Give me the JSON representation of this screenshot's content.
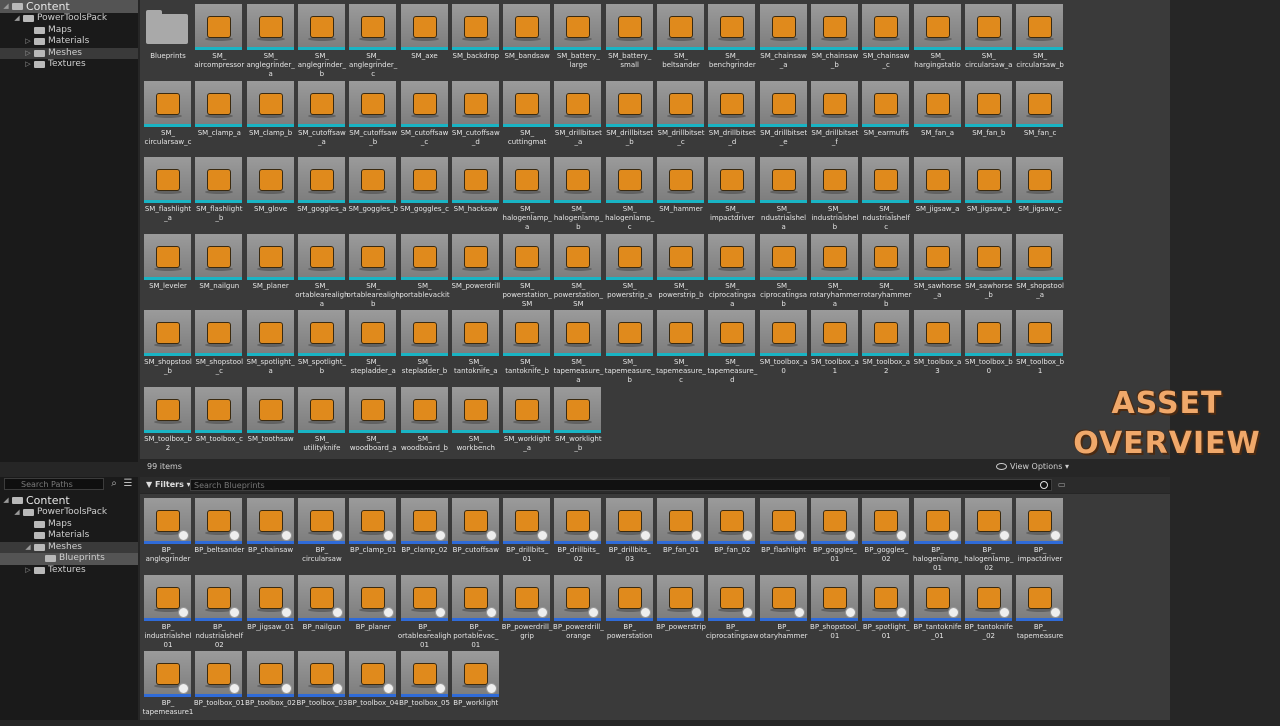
{
  "top_tree": [
    {
      "label": "Content",
      "level": 0,
      "root": true,
      "arrow": "◢",
      "selected": true
    },
    {
      "label": "PowerToolsPack",
      "level": 1,
      "arrow": "◢"
    },
    {
      "label": "Maps",
      "level": 2,
      "arrow": ""
    },
    {
      "label": "Materials",
      "level": 2,
      "arrow": "▷"
    },
    {
      "label": "Meshes",
      "level": 2,
      "arrow": "▷",
      "highlight": true
    },
    {
      "label": "Textures",
      "level": 2,
      "arrow": "▷"
    }
  ],
  "bottom_tree": [
    {
      "label": "Content",
      "level": 0,
      "root": true,
      "arrow": "◢"
    },
    {
      "label": "PowerToolsPack",
      "level": 1,
      "arrow": "◢"
    },
    {
      "label": "Maps",
      "level": 2,
      "arrow": ""
    },
    {
      "label": "Materials",
      "level": 2,
      "arrow": ""
    },
    {
      "label": "Meshes",
      "level": 2,
      "arrow": "◢",
      "highlight": true
    },
    {
      "label": "Blueprints",
      "level": 3,
      "arrow": "",
      "selected": true
    },
    {
      "label": "Textures",
      "level": 2,
      "arrow": "▷"
    }
  ],
  "search_paths_placeholder": "Search Paths",
  "mesh_assets": [
    "Blueprints",
    "SM_\naircompressor",
    "SM_\nanglegrinder_\na",
    "SM_\nanglegrinder_\nb",
    "SM_\nanglegrinder_\nc",
    "SM_axe",
    "SM_backdrop",
    "SM_bandsaw",
    "SM_battery_\nlarge",
    "SM_battery_\nsmall",
    "SM_\nbeltsander",
    "SM_\nbenchgrinder",
    "SM_chainsaw\n_a",
    "SM_chainsaw\n_b",
    "SM_chainsaw\n_c",
    "SM_\nhargingstatio",
    "SM_\ncircularsaw_a",
    "SM_\ncircularsaw_b",
    "SM_\ncircularsaw_c",
    "SM_clamp_a",
    "SM_clamp_b",
    "SM_cutoffsaw\n_a",
    "SM_cutoffsaw\n_b",
    "SM_cutoffsaw\n_c",
    "SM_cutoffsaw\n_d",
    "SM_\ncuttingmat",
    "SM_drillbitset\n_a",
    "SM_drillbitset\n_b",
    "SM_drillbitset\n_c",
    "SM_drillbitset\n_d",
    "SM_drillbitset\n_e",
    "SM_drillbitset\n_f",
    "SM_earmuffs",
    "SM_fan_a",
    "SM_fan_b",
    "SM_fan_c",
    "SM_flashlight\n_a",
    "SM_flashlight\n_b",
    "SM_glove",
    "SM_goggles_a",
    "SM_goggles_b",
    "SM_goggles_c",
    "SM_hacksaw",
    "SM_\nhalogenlamp_\na",
    "SM_\nhalogenlamp_\nb",
    "SM_\nhalogenlamp_\nc",
    "SM_hammer",
    "SM_\nimpactdriver",
    "SM_\nndustrialshel\na",
    "SM_\nindustrialshel\nb",
    "SM_\nndustrialshelf\nc",
    "SM_jigsaw_a",
    "SM_jigsaw_b",
    "SM_jigsaw_c",
    "SM_leveler",
    "SM_nailgun",
    "SM_planer",
    "SM_\nortablearealigh\na",
    "SM_\nortablearealigh\nb",
    "SM_\nportablevackit",
    "SM_powerdrill",
    "SM_\npowerstation_\nSM",
    "SM_\npowerstation_\nSM",
    "SM_\npowerstrip_a",
    "SM_\npowerstrip_b",
    "SM_\nciprocatingsa\na",
    "SM_\nciprocatingsa\nb",
    "SM_\nrotaryhammer\na",
    "SM_\nrotaryhammer\nb",
    "SM_sawhorse\n_a",
    "SM_sawhorse\n_b",
    "SM_shopstool\n_a",
    "SM_shopstool\n_b",
    "SM_shopstool\n_c",
    "SM_spotlight_\na",
    "SM_spotlight_\nb",
    "SM_\nstepladder_a",
    "SM_\nstepladder_b",
    "SM_\ntantoknife_a",
    "SM_\ntantoknife_b",
    "SM_\ntapemeasure_\na",
    "SM_\ntapemeasure_\nb",
    "SM_\ntapemeasure_\nc",
    "SM_\ntapemeasure_\nd",
    "SM_toolbox_a\n0",
    "SM_toolbox_a\n1",
    "SM_toolbox_a\n2",
    "SM_toolbox_a\n3",
    "SM_toolbox_b\n0",
    "SM_toolbox_b\n1",
    "SM_toolbox_b\n2",
    "SM_toolbox_c",
    "SM_toothsaw",
    "SM_\nutilityknife",
    "SM_\nwoodboard_a",
    "SM_\nwoodboard_b",
    "SM_\nworkbench",
    "SM_worklight\n_a",
    "SM_worklight\n_b"
  ],
  "items_count": "99 items",
  "view_options": "View Options",
  "filters_label": "Filters",
  "search_blueprints_placeholder": "Search Blueprints",
  "blueprint_assets": [
    "BP_\nanglegrinder",
    "BP_beltsander",
    "BP_chainsaw",
    "BP_\ncircularsaw",
    "BP_clamp_01",
    "BP_clamp_02",
    "BP_cutoffsaw",
    "BP_drillbits_\n01",
    "BP_drillbits_\n02",
    "BP_drillbits_\n03",
    "BP_fan_01",
    "BP_fan_02",
    "BP_flashlight",
    "BP_goggles_\n01",
    "BP_goggles_\n02",
    "BP_\nhalogenlamp_\n01",
    "BP_\nhalogenlamp_\n02",
    "BP_\nimpactdriver",
    "BP_\nindustrialshel\n01",
    "BP_\nndustrialshelf\n02",
    "BP_jigsaw_01",
    "BP_nailgun",
    "BP_planer",
    "BP_\nortablearealigh\n01",
    "BP_\nportablevac_\n01",
    "BP_powerdrill_\ngrip",
    "BP_powerdrill_\norange",
    "BP_\npowerstation",
    "BP_powerstrip",
    "BP_\nciprocatingsaw",
    "BP_\notaryhammer",
    "BP_shopstool_\n01",
    "BP_spotlight_\n01",
    "BP_tantoknife\n_01",
    "BP_tantoknife\n_02",
    "BP_\ntapemeasure",
    "BP_\ntapemeasure1",
    "BP_toolbox_01",
    "BP_toolbox_02",
    "BP_toolbox_03",
    "BP_toolbox_04",
    "BP_toolbox_05",
    "BP_worklight"
  ],
  "overview_line1": "ASSET",
  "overview_line2": "OVERVIEW",
  "colors": {
    "mesh_strip": "#19b4c4",
    "blueprint_strip": "#2f6bd8",
    "accent_orange": "#e08a1c",
    "overview_text": "#f0a86a"
  }
}
